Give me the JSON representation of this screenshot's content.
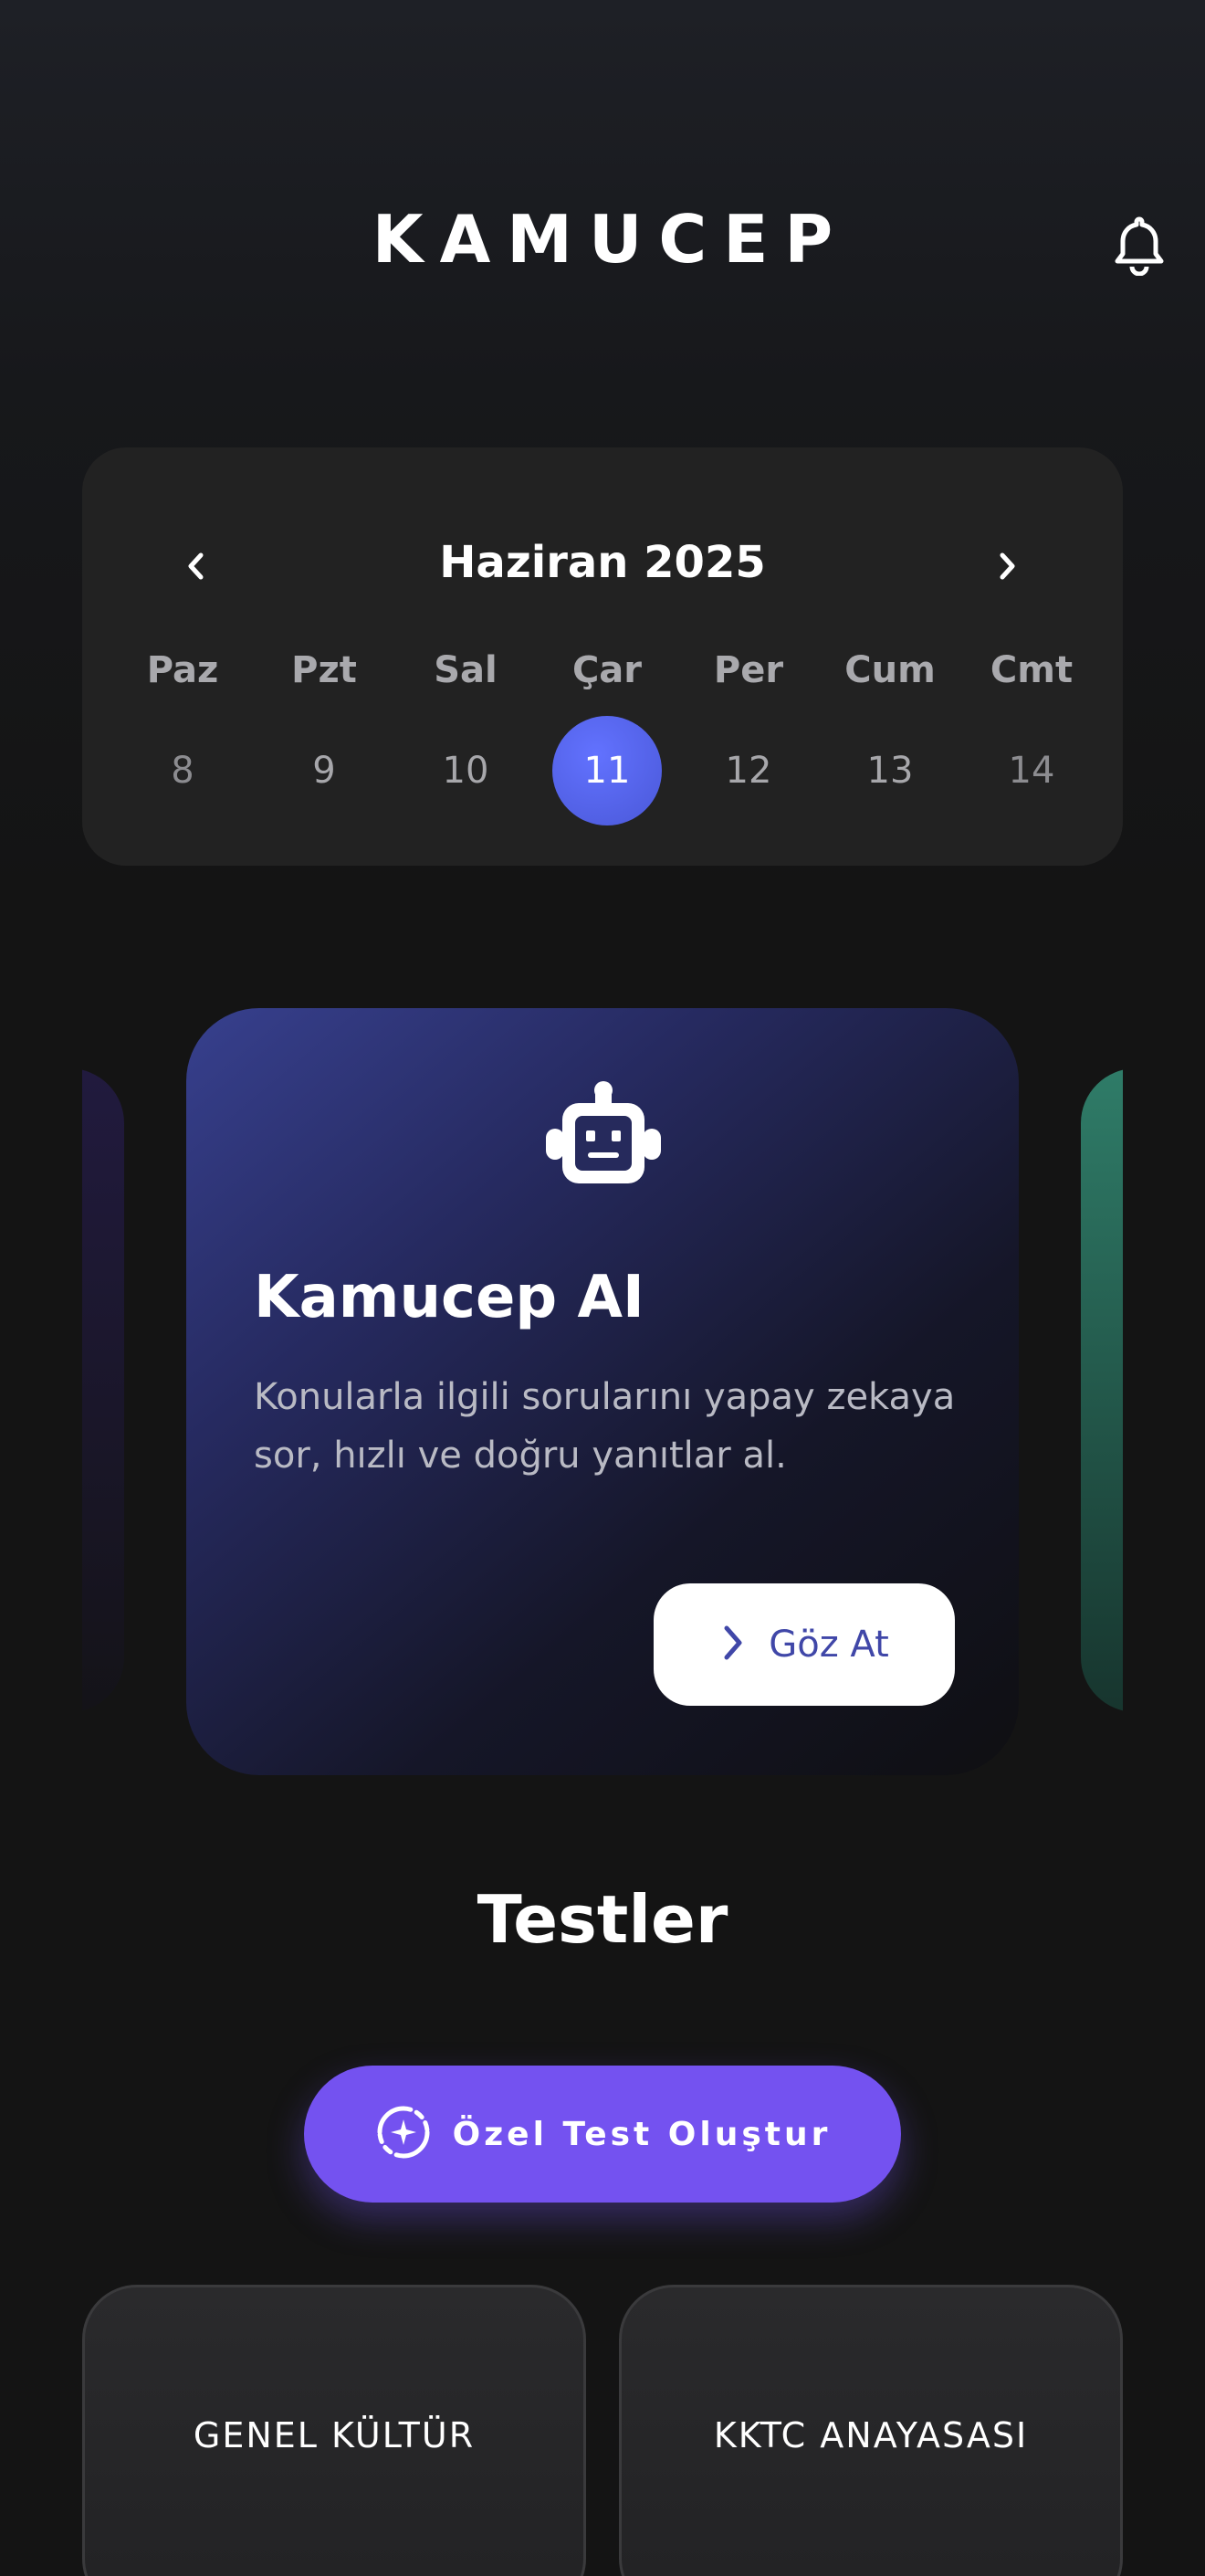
{
  "header": {
    "brand": "KAMUCEP",
    "bell_icon": "bell-icon"
  },
  "calendar": {
    "title": "Haziran 2025",
    "prev_icon": "chevron-left-icon",
    "next_icon": "chevron-right-icon",
    "days": [
      {
        "name": "Paz",
        "num": "8"
      },
      {
        "name": "Pzt",
        "num": "9"
      },
      {
        "name": "Sal",
        "num": "10"
      },
      {
        "name": "Çar",
        "num": "11",
        "selected": true
      },
      {
        "name": "Per",
        "num": "12"
      },
      {
        "name": "Cum",
        "num": "13"
      },
      {
        "name": "Cmt",
        "num": "14"
      }
    ]
  },
  "ai_card": {
    "icon": "robot-icon",
    "title": "Kamucep AI",
    "description": "Konularla ilgili sorularını yapay zekaya sor, hızlı ve doğru yanıtlar al.",
    "button_label": "Göz At",
    "button_icon": "chevron-right-icon"
  },
  "tests": {
    "title": "Testler",
    "create_button": "Özel Test Oluştur",
    "create_icon": "sparkle-refresh-icon",
    "categories": [
      "GENEL KÜLTÜR",
      "KKTC ANAYASASI"
    ]
  },
  "colors": {
    "accent_purple": "#7452f0",
    "selected_day": "#5664ee",
    "card_bg": "#222222"
  }
}
